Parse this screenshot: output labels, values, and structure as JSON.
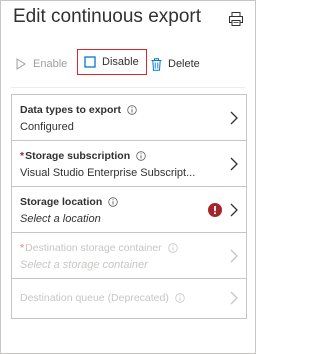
{
  "header": {
    "title": "Edit continuous export"
  },
  "toolbar": {
    "enable_label": "Enable",
    "disable_label": "Disable",
    "delete_label": "Delete"
  },
  "rows": [
    {
      "label": "Data types to export",
      "value": "Configured",
      "required": false
    },
    {
      "label": "Storage subscription",
      "value": "Visual Studio Enterprise Subscript...",
      "required": true
    },
    {
      "label": "Storage location",
      "value": "Select a location",
      "required": false
    },
    {
      "label": "Destination storage container",
      "value": "Select a storage container",
      "required": true
    },
    {
      "label": "Destination queue (Deprecated)",
      "value": "",
      "required": false
    }
  ],
  "colors": {
    "highlight_border": "#e3242b",
    "error_icon": "#a4262c",
    "accent": "#0078d4"
  }
}
